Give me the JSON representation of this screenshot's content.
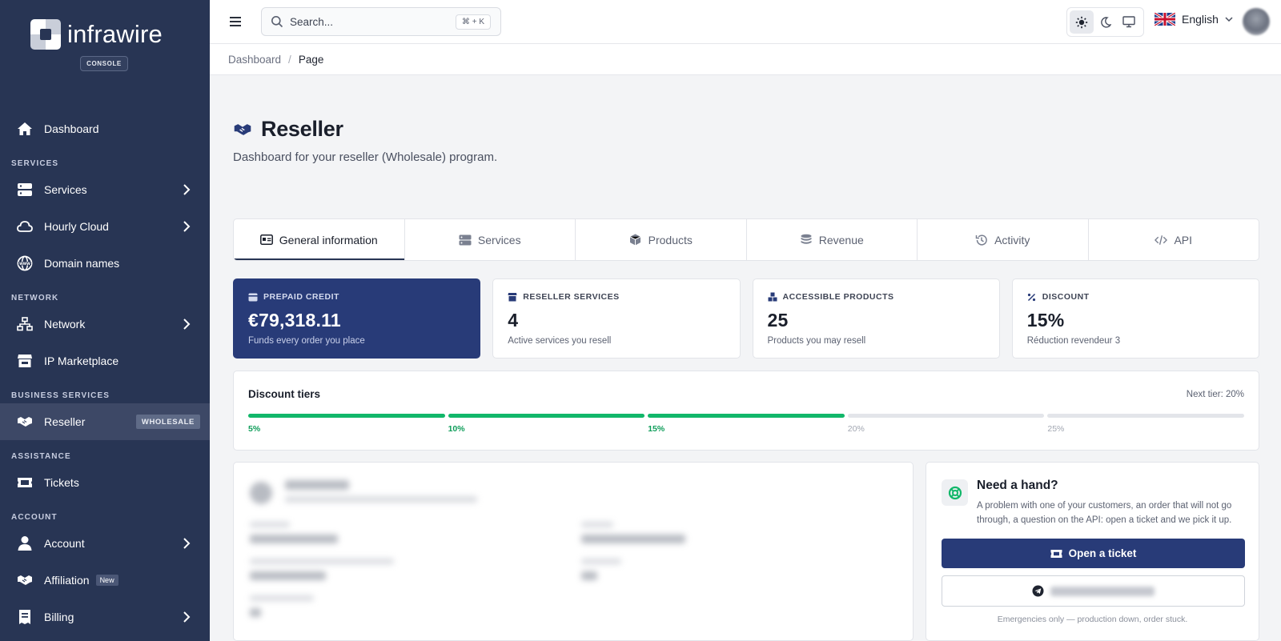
{
  "brand": {
    "name": "infrawire",
    "badge": "CONSOLE"
  },
  "sidebar": {
    "dashboard": "Dashboard",
    "sections": {
      "services": "SERVICES",
      "network": "NETWORK",
      "business": "BUSINESS SERVICES",
      "assistance": "ASSISTANCE",
      "account": "ACCOUNT"
    },
    "items": {
      "services": "Services",
      "hourly_cloud": "Hourly Cloud",
      "domain_names": "Domain names",
      "network": "Network",
      "ip_marketplace": "IP Marketplace",
      "reseller": "Reseller",
      "reseller_badge": "WHOLESALE",
      "tickets": "Tickets",
      "account": "Account",
      "affiliation": "Affiliation",
      "affiliation_badge": "New",
      "billing": "Billing"
    }
  },
  "topbar": {
    "search_placeholder": "Search...",
    "search_shortcut": "⌘ + K",
    "language": "English"
  },
  "breadcrumb": {
    "prev": "Dashboard",
    "sep": "/",
    "current": "Page"
  },
  "page": {
    "title": "Reseller",
    "subtitle": "Dashboard for your reseller (Wholesale) program."
  },
  "tabs": [
    {
      "label": "General information",
      "icon": "id-card-icon"
    },
    {
      "label": "Services",
      "icon": "server-icon"
    },
    {
      "label": "Products",
      "icon": "box-icon"
    },
    {
      "label": "Revenue",
      "icon": "coins-icon"
    },
    {
      "label": "Activity",
      "icon": "history-icon"
    },
    {
      "label": "API",
      "icon": "code-icon"
    }
  ],
  "cards": [
    {
      "label": "PREPAID CREDIT",
      "value": "€79,318.11",
      "desc": "Funds every order you place"
    },
    {
      "label": "RESELLER SERVICES",
      "value": "4",
      "desc": "Active services you resell"
    },
    {
      "label": "ACCESSIBLE PRODUCTS",
      "value": "25",
      "desc": "Products you may resell"
    },
    {
      "label": "DISCOUNT",
      "value": "15%",
      "desc": "Réduction revendeur 3"
    }
  ],
  "tiers": {
    "title": "Discount tiers",
    "next": "Next tier: 20%",
    "levels": [
      "5%",
      "10%",
      "15%",
      "20%",
      "25%"
    ],
    "reached_count": 3
  },
  "help": {
    "title": "Need a hand?",
    "text": "A problem with one of your customers, an order that will not go through, a question on the API: open a ticket and we pick it up.",
    "ticket_button": "Open a ticket",
    "footer": "Emergencies only — production down, order stuck."
  },
  "colors": {
    "sidebar_bg": "#283554",
    "primary": "#283b78",
    "success": "#12b76a"
  }
}
